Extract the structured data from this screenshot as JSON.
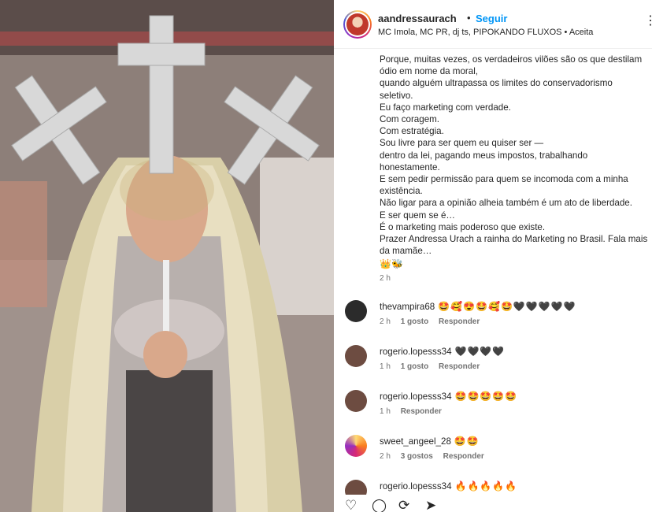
{
  "header": {
    "username": "aandressaurach",
    "dot": "•",
    "follow_label": "Seguir",
    "audio": "MC Imola, MC PR, dj ts, PIPOKANDO FLUXOS • Aceita",
    "more": "⋮"
  },
  "caption": {
    "lines": [
      "Porque, muitas vezes, os verdadeiros vilões são os que destilam",
      "ódio em nome da moral,",
      "quando alguém ultrapassa os limites do conservadorismo",
      "seletivo.",
      "Eu faço marketing com verdade.",
      "Com coragem.",
      "Com estratégia.",
      "Sou livre para ser quem eu quiser ser —",
      "dentro da lei, pagando meus impostos, trabalhando",
      "honestamente.",
      "E sem pedir permissão para quem se incomoda com a minha",
      "existência.",
      "Não ligar para a opinião alheia também é um ato de liberdade.",
      "E ser quem se é…",
      "É o marketing mais poderoso que existe.",
      "Prazer Andressa Urach a rainha do Marketing no Brasil. Fala mais",
      "da mamãe…"
    ],
    "emojis": "👑🐝",
    "time": "2 h"
  },
  "comments": [
    {
      "user": "thevampira68",
      "text": "🤩🥰😍🤩🥰🤩🖤🖤🖤🖤🖤",
      "time": "2 h",
      "likes": "1 gosto",
      "reply": "Responder",
      "avatar_color": "#2b2b2b"
    },
    {
      "user": "rogerio.lopesss34",
      "text": "🖤🖤🖤🖤",
      "time": "1 h",
      "likes": "1 gosto",
      "reply": "Responder",
      "avatar_color": "#6d4c41"
    },
    {
      "user": "rogerio.lopesss34",
      "text": "🤩🤩🤩🤩🤩",
      "time": "1 h",
      "likes": "",
      "reply": "Responder",
      "avatar_color": "#6d4c41"
    },
    {
      "user": "sweet_angeel_28",
      "text": "🤩🤩",
      "time": "2 h",
      "likes": "3 gostos",
      "reply": "Responder",
      "avatar_color": "#d4a373"
    },
    {
      "user": "rogerio.lopesss34",
      "text": "🔥🔥🔥🔥🔥",
      "time": "",
      "likes": "",
      "reply": "",
      "avatar_color": "#6d4c41"
    }
  ],
  "actions": {
    "like_icon": "heart-icon",
    "comment_icon": "comment-icon",
    "share_icon": "share-icon",
    "save_icon": "bookmark-icon"
  },
  "colors": {
    "link_blue": "#0095f6",
    "meta_gray": "#737373"
  }
}
